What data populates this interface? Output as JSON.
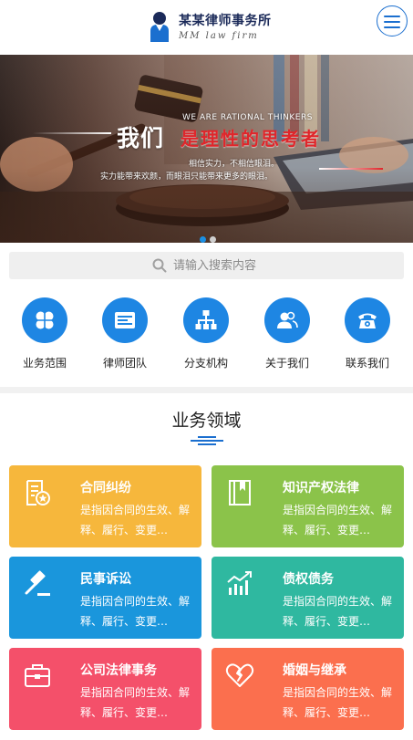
{
  "header": {
    "brand_cn": "某某律师事务所",
    "brand_en": "MM law firm",
    "menu_icon": "hamburger-menu-icon",
    "brand_color": "#1b6fcf"
  },
  "banner": {
    "slogan_white": "我们",
    "slogan_red": "是理性的思考者",
    "slogan_en": "WE ARE RATIONAL THINKERS",
    "line1": "相信实力，不相信眼泪。",
    "line2": "实力能带来欢颜，而眼泪只能带来更多的眼泪。",
    "slide_count": 2,
    "active_slide": 1
  },
  "search": {
    "placeholder": "请输入搜索内容",
    "value": "",
    "icon": "search-icon"
  },
  "quicknav": [
    {
      "label": "业务范围",
      "icon": "four-leaf-icon"
    },
    {
      "label": "律师团队",
      "icon": "id-card-icon"
    },
    {
      "label": "分支机构",
      "icon": "org-chart-icon"
    },
    {
      "label": "关于我们",
      "icon": "users-icon"
    },
    {
      "label": "联系我们",
      "icon": "telephone-icon"
    }
  ],
  "quicknav_color": "#1e86e3",
  "section": {
    "title": "业务领域"
  },
  "cards": [
    {
      "title": "合同纠纷",
      "desc": "是指因合同的生效、解释、履行、变更…",
      "color": "#f6b73c",
      "icon": "contract-document-icon"
    },
    {
      "title": "知识产权法律",
      "desc": "是指因合同的生效、解释、履行、变更…",
      "color": "#8bc34a",
      "icon": "bookmark-book-icon"
    },
    {
      "title": "民事诉讼",
      "desc": "是指因合同的生效、解释、履行、变更…",
      "color": "#1a96dc",
      "icon": "gavel-icon"
    },
    {
      "title": "债权债务",
      "desc": "是指因合同的生效、解释、履行、变更…",
      "color": "#2fb8a0",
      "icon": "bar-chart-trend-icon"
    },
    {
      "title": "公司法律事务",
      "desc": "是指因合同的生效、解释、履行、变更…",
      "color": "#f4506a",
      "icon": "briefcase-icon"
    },
    {
      "title": "婚姻与继承",
      "desc": "是指因合同的生效、解释、履行、变更…",
      "color": "#fb6f4e",
      "icon": "broken-heart-icon"
    }
  ]
}
